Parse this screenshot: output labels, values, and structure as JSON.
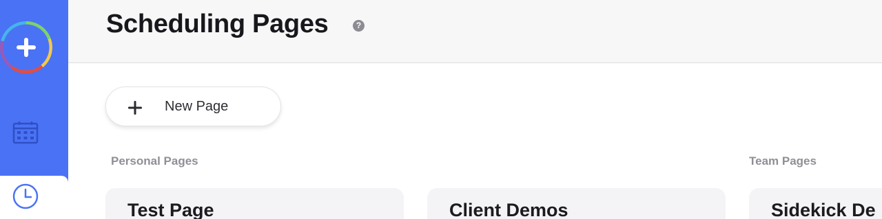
{
  "header": {
    "title": "Scheduling Pages",
    "help_glyph": "?"
  },
  "sidebar": {
    "items": [
      {
        "name": "create-new",
        "icon": "plus-icon"
      },
      {
        "name": "calendar",
        "icon": "calendar-icon"
      },
      {
        "name": "scheduling-pages",
        "icon": "clock-icon",
        "active": true
      }
    ],
    "colors": {
      "background": "#4a72f5",
      "icon": "#2f4fc6"
    }
  },
  "toolbar": {
    "new_page_label": "New Page"
  },
  "sections": {
    "personal": {
      "label": "Personal Pages"
    },
    "team": {
      "label": "Team Pages"
    }
  },
  "cards": [
    {
      "title": "Test Page"
    },
    {
      "title": "Client Demos"
    },
    {
      "title": "Sidekick De"
    }
  ]
}
